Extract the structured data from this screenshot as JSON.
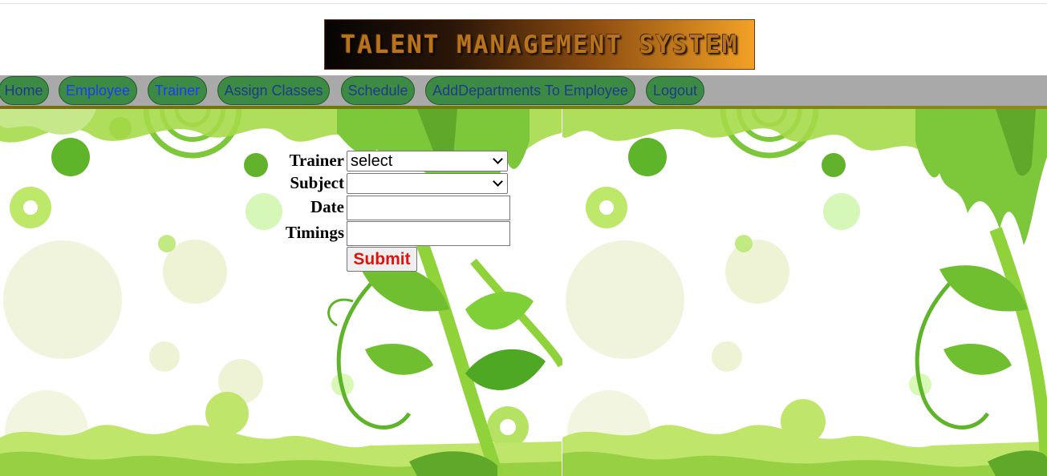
{
  "banner": {
    "text": "TALENT MANAGEMENT SYSTEM"
  },
  "nav": {
    "items": [
      {
        "label": "Home"
      },
      {
        "label": "Employee"
      },
      {
        "label": "Trainer"
      },
      {
        "label": "Assign Classes"
      },
      {
        "label": "Schedule"
      },
      {
        "label": "AddDepartments To Employee"
      },
      {
        "label": "Logout"
      }
    ],
    "colors": {
      "bar": "#a9a9a9",
      "pill": "#3d8a45",
      "link": "#1d3b8a",
      "link_active": "#1a3ef2"
    }
  },
  "form": {
    "trainer": {
      "label": "Trainer",
      "value": "select"
    },
    "subject": {
      "label": "Subject",
      "value": ""
    },
    "date": {
      "label": "Date",
      "value": ""
    },
    "timings": {
      "label": "Timings",
      "value": ""
    },
    "submit": {
      "label": "Submit",
      "color": "#e0110e"
    }
  },
  "background": {
    "theme": "green-floral-splash",
    "accent": "#9fd833"
  }
}
